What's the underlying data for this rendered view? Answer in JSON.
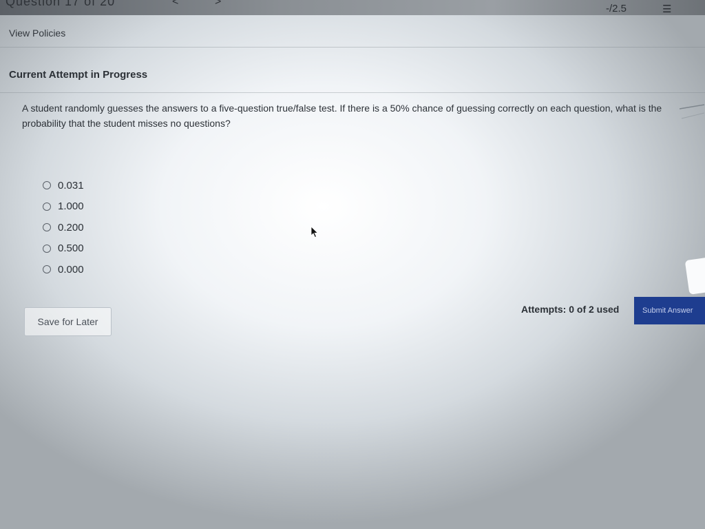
{
  "header": {
    "question_counter": "Question 17 of 20",
    "prev_symbol": "<",
    "next_symbol": ">",
    "score": "-/2.5",
    "list_icon_glyph": "☰"
  },
  "links": {
    "view_policies": "View Policies"
  },
  "attempt": {
    "heading": "Current Attempt in Progress"
  },
  "question": {
    "text": "A student randomly guesses the answers to a five-question true/false test. If there is a 50% chance of guessing correctly on each question, what is the probability that the student misses no questions?"
  },
  "options": [
    {
      "label": "0.031"
    },
    {
      "label": "1.000"
    },
    {
      "label": "0.200"
    },
    {
      "label": "0.500"
    },
    {
      "label": "0.000"
    }
  ],
  "footer": {
    "save_label": "Save for Later",
    "attempts_text": "Attempts: 0 of 2 used",
    "submit_label": "Submit Answer"
  },
  "colors": {
    "submit_bg": "#1e3d8f",
    "text": "#2b3036"
  }
}
